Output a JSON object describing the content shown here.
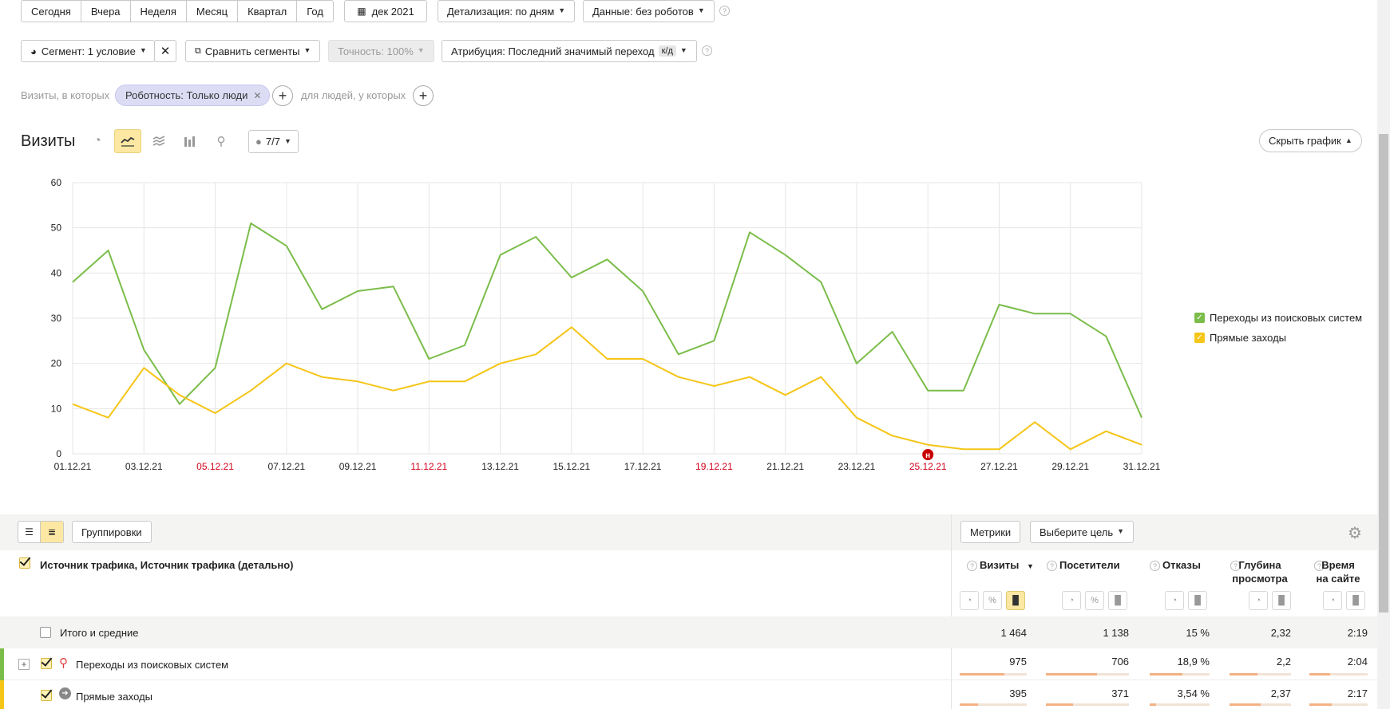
{
  "toolbar": {
    "periods": [
      "Сегодня",
      "Вчера",
      "Неделя",
      "Месяц",
      "Квартал",
      "Год"
    ],
    "date_range": "дек 2021",
    "detail": "Детализация: по дням",
    "data": "Данные: без роботов"
  },
  "toolbar2": {
    "segment": "Сегмент: 1 условие",
    "compare": "Сравнить сегменты",
    "accuracy": "Точность: 100%",
    "attribution": "Атрибуция: Последний значимый переход",
    "attribution_badge": "к/д"
  },
  "filter": {
    "visits_prefix": "Визиты, в которых",
    "tag": "Роботность: Только люди",
    "people_label": "для людей, у которых"
  },
  "chart_header": {
    "title": "Визиты",
    "annotations": "7/7",
    "hide_chart": "Скрыть график"
  },
  "chart_data": {
    "type": "line",
    "x": [
      "01.12.21",
      "02.12.21",
      "03.12.21",
      "04.12.21",
      "05.12.21",
      "06.12.21",
      "07.12.21",
      "08.12.21",
      "09.12.21",
      "10.12.21",
      "11.12.21",
      "12.12.21",
      "13.12.21",
      "14.12.21",
      "15.12.21",
      "16.12.21",
      "17.12.21",
      "18.12.21",
      "19.12.21",
      "20.12.21",
      "21.12.21",
      "22.12.21",
      "23.12.21",
      "24.12.21",
      "25.12.21",
      "26.12.21",
      "27.12.21",
      "28.12.21",
      "29.12.21",
      "30.12.21",
      "31.12.21"
    ],
    "tick_labels": [
      "01.12.21",
      "03.12.21",
      "05.12.21",
      "07.12.21",
      "09.12.21",
      "11.12.21",
      "13.12.21",
      "15.12.21",
      "17.12.21",
      "19.12.21",
      "21.12.21",
      "23.12.21",
      "25.12.21",
      "27.12.21",
      "29.12.21",
      "31.12.21"
    ],
    "weekend_ticks": [
      "05.12.21",
      "11.12.21",
      "19.12.21",
      "25.12.21"
    ],
    "y_ticks": [
      "0",
      "10",
      "20",
      "30",
      "40",
      "50",
      "60"
    ],
    "ylim": [
      0,
      60
    ],
    "holiday_marker": {
      "date": "25.12.21",
      "label": "н"
    },
    "series": [
      {
        "name": "Переходы из поисковых систем",
        "color": "#7bbd4a",
        "values": [
          38,
          45,
          23,
          11,
          19,
          51,
          46,
          32,
          36,
          37,
          21,
          24,
          44,
          48,
          39,
          43,
          36,
          22,
          25,
          49,
          44,
          38,
          20,
          27,
          14,
          14,
          33,
          31,
          31,
          26,
          8
        ]
      },
      {
        "name": "Прямые заходы",
        "color": "#f5c518",
        "values": [
          11,
          8,
          19,
          13,
          9,
          14,
          20,
          17,
          16,
          14,
          16,
          16,
          20,
          22,
          28,
          21,
          21,
          17,
          15,
          17,
          13,
          17,
          8,
          4,
          2,
          1,
          1,
          7,
          1,
          5,
          2
        ]
      }
    ],
    "grid": true,
    "legend_position": "right"
  },
  "table": {
    "groupings_button": "Группировки",
    "metrics_button": "Метрики",
    "goal_button": "Выберите цель",
    "dimension_header": "Источник трафика, Источник трафика (детально)",
    "columns": [
      {
        "label": "Визиты",
        "sort": "▼"
      },
      {
        "label": "Посетители"
      },
      {
        "label": "Отказы"
      },
      {
        "label": "Глубина просмотра"
      },
      {
        "label": "Время на сайте"
      }
    ],
    "totals_label": "Итого и средние",
    "totals": [
      "1 464",
      "1 138",
      "15 %",
      "2,32",
      "2:19"
    ],
    "rows": [
      {
        "label": "Переходы из поисковых систем",
        "values": [
          "975",
          "706",
          "18,9 %",
          "2,2",
          "2:04"
        ],
        "color": "#7bbd4a",
        "bars": [
          0.67,
          0.62,
          0.55,
          0.45,
          0.35
        ]
      },
      {
        "label": "Прямые заходы",
        "values": [
          "395",
          "371",
          "3,54 %",
          "2,37",
          "2:17"
        ],
        "color": "#f5c518",
        "bars": [
          0.27,
          0.33,
          0.1,
          0.5,
          0.38
        ]
      }
    ]
  },
  "icons": {
    "calendar": "calendar-icon",
    "settings": "gear-icon",
    "search_source": "magnifier-icon",
    "direct_source": "arrow-in-icon"
  }
}
